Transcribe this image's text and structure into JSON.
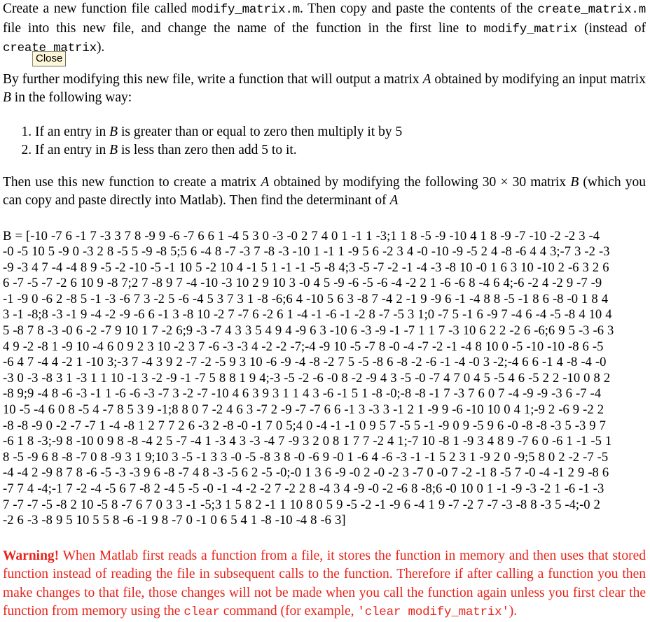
{
  "document": {
    "intro": {
      "seg1": "Create a new function file called ",
      "file1": "modify_matrix.m",
      "seg2": ". Then copy and paste the contents of the ",
      "file2": "create_matrix.m",
      "seg3": " file into this new file, and change the name of the function in the first line to ",
      "file3": "modify_matrix",
      "seg4": " (instead of ",
      "file4": "create_matrix",
      "seg5": ")."
    },
    "close_button": "Close",
    "paragraph2": {
      "seg1": "By further modifying this new file, write a function that will output a matrix ",
      "var_a": "A",
      "seg2": " obtained by modifying an input matrix ",
      "var_b": "B",
      "seg3": " in the following way:"
    },
    "rules": [
      {
        "seg1": "If an entry in ",
        "var": "B",
        "seg2": " is greater than or equal to zero then multiply it by 5"
      },
      {
        "seg1": "If an entry in ",
        "var": "B",
        "seg2": " is less than zero then add 5 to it."
      }
    ],
    "paragraph3": {
      "seg1": "Then use this new function to create a matrix ",
      "var_a": "A",
      "seg2": " obtained by modifying the following 30 × 30 matrix ",
      "var_b": "B",
      "seg3": " (which you can copy and paste directly into Matlab). Then find the determinant of ",
      "var_a2": "A"
    },
    "matrix_label": "B = [",
    "matrix_lines": [
      "-10 -7 6 -1 7 -3 3 7 8 -9 9 -6 -7 6 6 1 -4 5 3 0 -3 -0 2 7 4 0 1 -1 1 -3;1 1 8 -5 -9 -10 4 1 8 -9 -7 -10 -2 -2 3 -4",
      "-0 -5 10 5 -9 0 -3 2 8 -5 5 -9 -8 5;5 6 -4 8 -7 -3 7 -8 -3 -10 1 -1 1 -9 5 6 -2 3 4 -0 -10 -9 -5 2 4 -8 -6 4 4 3;-7 3 -2 -3",
      "-9 -3 4 7 -4 -4 8 9 -5 -2 -10 -5 -1 10 5 -2 10 4 -1 5 1 -1 -1 -5 -8 4;3 -5 -7 -2 -1 -4 -3 -8 10 -0 1 6 3 10 -10 2 -6 3 2 6",
      "6 -7 -5 -7 -2 6 10 9 -8 7;2 7 -8 9 7 -4 -10 -3 10 2 9 10 3 -0 4 5 -9 -6 -5 -6 -4 -2 2 1 -6 -6 8 -4 6 4;-6 -2 4 -2 9 -7 -9",
      "-1 -9 0 -6 2 -8 5 -1 -3 -6 7 3 -2 5 -6 -4 5 3 7 3 1 -8 -6;6 4 -10 5 6 3 -8 7 -4 2 -1 9 -9 6 -1 -4 8 8 -5 -1 8 6 -8 -0 1 8 4",
      "3 -1 -8;8 -3 -1 9 -4 -2 -9 -6 6 -1 3 -8 10 -2 7 -7 6 -2 6 1 -4 -1 -6 -1 -2 8 -7 -5 3 1;0 -7 5 -1 6 -9 7 -4 6 -4 -5 -8 4 10 4",
      "5 -8 7 8 -3 -0 6 -2 -7 9 10 1 7 -2 6;9 -3 -7 4 3 3 5 4 9 4 -9 6 3 -10 6 -3 -9 -1 -7 1 1 7 -3 10 6 2 2 -2 6 -6;6 9 5 -3 -6 3",
      "4 9 -2 -8 1 -9 10 -4 6 0 9 2 3 10 -2 3 7 -6 -3 -3 4 -2 -2 -7;-4 -9 10 -5 -7 8 -0 -4 -7 -2 -1 -4 8 10 0 -5 -10 -10 -8 6 -5",
      "-6 4 7 -4 4 -2 1 -10 3;-3 7 -4 3 9 2 -7 -2 -5 9 3 10 -6 -9 -4 -8 -2 7 5 -5 -8 6 -8 -2 -6 -1 -4 -0 3 -2;-4 6 6 -1 4 -8 -4 -0",
      "-3 0 -3 -8 3 1 -3 1 1 10 -1 3 -2 -9 -1 -7 5 8 8 1 9 4;-3 -5 -2 -6 -0 8 -2 -9 4 3 -5 -0 -7 4 7 0 4 5 -5 4 6 -5 2 2 -10 0 8 2",
      "-8 9;9 -4 8 -6 -3 -1 1 -6 -6 -3 -7 3 -2 -7 -10 4 6 3 9 3 1 1 4 3 -6 -1 5 1 -8 -0;-8 -8 -1 7 -3 7 6 0 7 -4 -9 -9 -3 6 -7 -4",
      "10 -5 -4 6 0 8 -5 4 -7 8 5 3 9 -1;8 8 0 7 -2 4 6 3 -7 2 -9 -7 -7 6 6 -1 3 -3 3 -1 2 1 -9 9 -6 -10 10 0 4 1;-9 2 -6 9 -2 2",
      "-8 -8 -9 0 -2 -7 -7 1 -4 -8 1 2 7 7 2 6 -3 2 -8 -0 -1 7 0 5;4 0 -4 -1 -1 0 9 5 7 -5 5 -1 -9 0 9 -5 9 6 -0 -8 -8 -3 5 -3 9 7",
      "-6 1 8 -3;-9 8 -10 0 9 8 -8 -4 2 5 -7 -4 1 -3 4 3 -3 -4 7 -9 3 2 0 8 1 7 7 -2 4 1;-7 10 -8 1 -9 3 4 8 9 -7 6 0 -6 1 -1 -5 1",
      "8 -5 -9 6 8 -8 -7 0 8 -9 3 1 9;10 3 -5 -1 3 3 -0 -5 -8 3 8 -0 -6 9 -0 1 -6 4 -6 -3 -1 -1 5 2 3 1 -9 2 0 -9;5 8 0 2 -2 -7 -5",
      "-4 -4 2 -9 8 7 8 -6 -5 -3 -3 9 6 -8 -7 4 8 -3 -5 6 2 -5 -0;-0 1 3 6 -9 -0 2 -0 -2 3 -7 0 -0 7 -2 -1 8 -5 7 -0 -4 -1 2 9 -8 6",
      "-7 7 4 -4;-1 7 -2 -4 -5 6 7 -8 2 -4 5 -5 -0 -1 -4 -2 -2 7 -2 2 8 -4 3 4 -9 -0 -2 -6 8 -8;6 -0 10 0 1 -1 -9 -3 -2 1 -6 -1 -3",
      "7 -7 -7 -5 -8 2 10 -5 8 -7 6 7 0 3 3 -1 -5;3 1 5 8 2 -1 1 10 8 0 5 9 -5 -2 -1 -9 6 -4 1 9 -7 -2 7 -7 -3 -8 8 -3 5 -4;-0 2",
      "-2 6 -3 -8 9 5 10 5 5 8 -6 -1 9 8 -7 0 -1 0 6 5 4 1 -8 -10 -4 8 -6 3]"
    ],
    "warning": {
      "label": "Warning!",
      "seg1": " When Matlab first reads a function from a file, it stores the function in memory and then uses that stored function instead of reading the file in subsequent calls to the function. Therefore if after calling a function you then make changes to that file, those changes will not be made when you call the function again unless you first clear the function from memory using the ",
      "cmd1": "clear",
      "seg2": " command (for example, ",
      "cmd2": "'clear modify_matrix'",
      "seg3": ")."
    },
    "colors": {
      "warning_red": "#e8231a",
      "close_bg": "#fdf6d8",
      "text": "#000000"
    }
  }
}
